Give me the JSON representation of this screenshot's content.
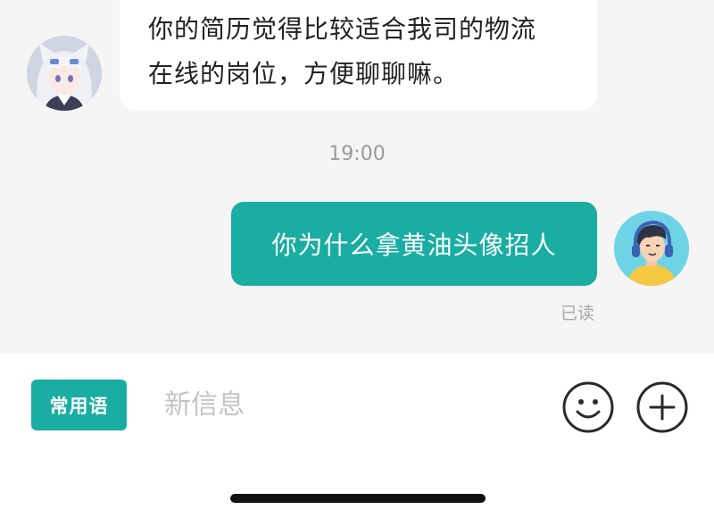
{
  "incoming_message": {
    "lines": [
      "你的简历觉得比较适合我司的物流",
      "在线的岗位，方便聊聊嘛。"
    ]
  },
  "timestamp": "19:00",
  "outgoing_message": {
    "text": "你为什么拿黄油头像招人",
    "status": "已读"
  },
  "input_bar": {
    "phrases_label": "常用语",
    "placeholder": "新信息",
    "value": "",
    "emoji_icon": "smiley-icon",
    "plus_icon": "plus-circle-icon"
  },
  "colors": {
    "accent": "#1aada2",
    "background": "#f5f5f5",
    "bubble_in": "#ffffff"
  }
}
